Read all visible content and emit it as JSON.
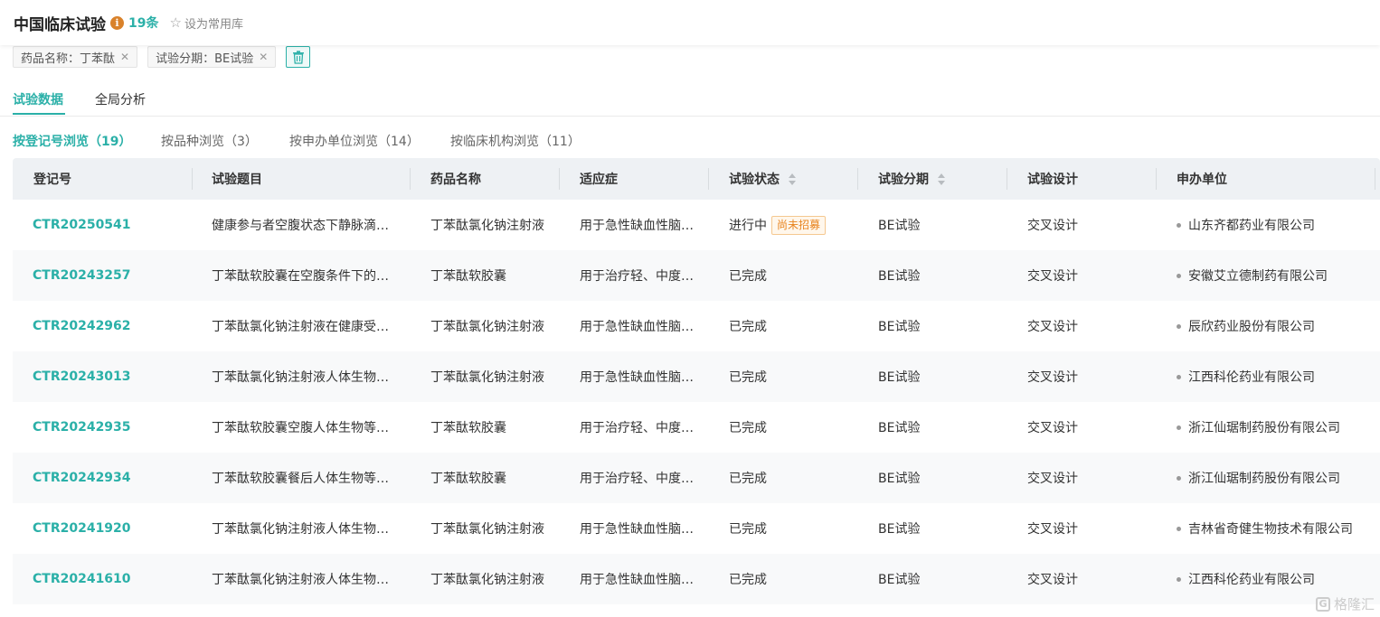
{
  "header": {
    "title": "中国临床试验",
    "info_icon": "i",
    "count": "19条",
    "favorite_label": "设为常用库"
  },
  "filters": [
    {
      "label": "药品名称：丁苯酞"
    },
    {
      "label": "试验分期：BE试验"
    }
  ],
  "tabs": [
    {
      "label": "试验数据",
      "active": true
    },
    {
      "label": "全局分析",
      "active": false
    }
  ],
  "subtabs": [
    {
      "label": "按登记号浏览（19）",
      "active": true
    },
    {
      "label": "按品种浏览（3）",
      "active": false
    },
    {
      "label": "按申办单位浏览（14）",
      "active": false
    },
    {
      "label": "按临床机构浏览（11）",
      "active": false
    }
  ],
  "table": {
    "columns": [
      "登记号",
      "试验题目",
      "药品名称",
      "适应症",
      "试验状态",
      "试验分期",
      "试验设计",
      "申办单位"
    ],
    "rows": [
      {
        "regno": "CTR20250541",
        "title": "健康参与者空腹状态下静脉滴…",
        "drug": "丁苯酞氯化钠注射液",
        "indication": "用于急性缺血性脑…",
        "status": "进行中",
        "badge": "尚未招募",
        "phase": "BE试验",
        "design": "交叉设计",
        "sponsor": "山东齐都药业有限公司"
      },
      {
        "regno": "CTR20243257",
        "title": "丁苯酞软胶囊在空腹条件下的…",
        "drug": "丁苯酞软胶囊",
        "indication": "用于治疗轻、中度…",
        "status": "已完成",
        "badge": "",
        "phase": "BE试验",
        "design": "交叉设计",
        "sponsor": "安徽艾立德制药有限公司"
      },
      {
        "regno": "CTR20242962",
        "title": "丁苯酞氯化钠注射液在健康受…",
        "drug": "丁苯酞氯化钠注射液",
        "indication": "用于急性缺血性脑…",
        "status": "已完成",
        "badge": "",
        "phase": "BE试验",
        "design": "交叉设计",
        "sponsor": "辰欣药业股份有限公司"
      },
      {
        "regno": "CTR20243013",
        "title": "丁苯酞氯化钠注射液人体生物…",
        "drug": "丁苯酞氯化钠注射液",
        "indication": "用于急性缺血性脑…",
        "status": "已完成",
        "badge": "",
        "phase": "BE试验",
        "design": "交叉设计",
        "sponsor": "江西科伦药业有限公司"
      },
      {
        "regno": "CTR20242935",
        "title": "丁苯酞软胶囊空腹人体生物等…",
        "drug": "丁苯酞软胶囊",
        "indication": "用于治疗轻、中度…",
        "status": "已完成",
        "badge": "",
        "phase": "BE试验",
        "design": "交叉设计",
        "sponsor": "浙江仙琚制药股份有限公司"
      },
      {
        "regno": "CTR20242934",
        "title": "丁苯酞软胶囊餐后人体生物等…",
        "drug": "丁苯酞软胶囊",
        "indication": "用于治疗轻、中度…",
        "status": "已完成",
        "badge": "",
        "phase": "BE试验",
        "design": "交叉设计",
        "sponsor": "浙江仙琚制药股份有限公司"
      },
      {
        "regno": "CTR20241920",
        "title": "丁苯酞氯化钠注射液人体生物…",
        "drug": "丁苯酞氯化钠注射液",
        "indication": "用于急性缺血性脑…",
        "status": "已完成",
        "badge": "",
        "phase": "BE试验",
        "design": "交叉设计",
        "sponsor": "吉林省奇健生物技术有限公司"
      },
      {
        "regno": "CTR20241610",
        "title": "丁苯酞氯化钠注射液人体生物…",
        "drug": "丁苯酞氯化钠注射液",
        "indication": "用于急性缺血性脑…",
        "status": "已完成",
        "badge": "",
        "phase": "BE试验",
        "design": "交叉设计",
        "sponsor": "江西科伦药业有限公司"
      }
    ]
  },
  "watermark": "格隆汇",
  "colors": {
    "accent": "#2bb0a8",
    "badge": "#e8841f",
    "header_bg": "#eef1f4"
  }
}
